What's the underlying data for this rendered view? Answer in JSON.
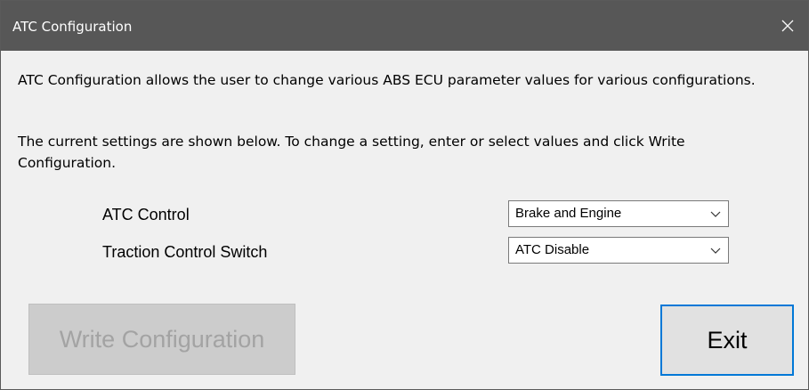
{
  "window": {
    "title": "ATC Configuration",
    "close_icon": "close-icon"
  },
  "description": {
    "line1": "ATC Configuration allows the user to change various ABS ECU parameter values for various configurations.",
    "line2": "The current settings are shown below. To change a setting, enter or select values and click Write Configuration."
  },
  "settings": [
    {
      "label": "ATC Control",
      "value": "Brake and Engine"
    },
    {
      "label": "Traction Control Switch",
      "value": "ATC Disable"
    }
  ],
  "buttons": {
    "write_label": "Write Configuration",
    "write_enabled": false,
    "exit_label": "Exit"
  },
  "colors": {
    "titlebar": "#575757",
    "focus_border": "#0078d7",
    "disabled_text": "#a3a3a3"
  }
}
